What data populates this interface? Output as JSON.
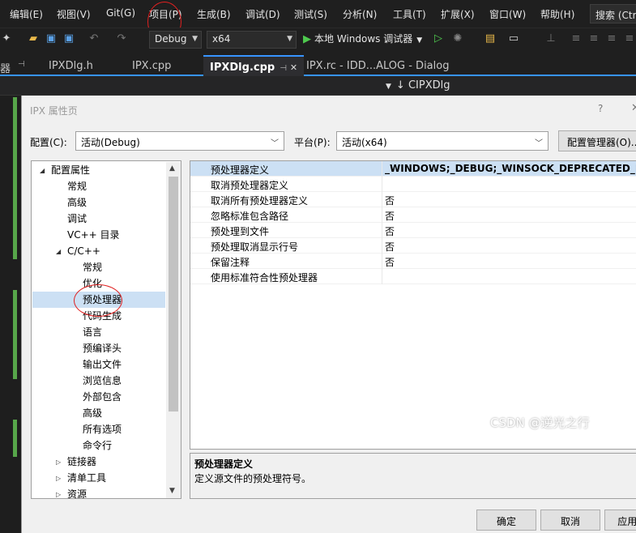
{
  "menu": {
    "items": [
      "编辑(E)",
      "视图(V)",
      "Git(G)",
      "项目(P)",
      "生成(B)",
      "调试(D)",
      "测试(S)",
      "分析(N)",
      "工具(T)",
      "扩展(X)",
      "窗口(W)",
      "帮助(H)"
    ],
    "search_label": "搜索 (Ctrl"
  },
  "toolbar": {
    "config_value": "Debug",
    "platform_value": "x64",
    "debugger_label": "本地 Windows 调试器"
  },
  "tabs": {
    "left_fragment": "器",
    "items": [
      "IPXDlg.h",
      "IPX.cpp",
      "IPXDlg.cpp",
      "IPX.rc - IDD...ALOG - Dialog"
    ]
  },
  "nav": {
    "class_name": "CIPXDlg"
  },
  "dialog": {
    "title": "IPX 属性页",
    "help_glyph": "?",
    "config_label": "配置(C):",
    "config_value": "活动(Debug)",
    "platform_label": "平台(P):",
    "platform_value": "活动(x64)",
    "config_manager_label": "配置管理器(O)...",
    "tree": [
      {
        "label": "配置属性",
        "twisty": "◢"
      },
      {
        "label": "常规"
      },
      {
        "label": "高级"
      },
      {
        "label": "调试"
      },
      {
        "label": "VC++ 目录"
      },
      {
        "label": "C/C++",
        "twisty": "◢"
      },
      {
        "label": "常规"
      },
      {
        "label": "优化"
      },
      {
        "label": "预处理器"
      },
      {
        "label": "代码生成"
      },
      {
        "label": "语言"
      },
      {
        "label": "预编译头"
      },
      {
        "label": "输出文件"
      },
      {
        "label": "浏览信息"
      },
      {
        "label": "外部包含"
      },
      {
        "label": "高级"
      },
      {
        "label": "所有选项"
      },
      {
        "label": "命令行"
      },
      {
        "label": "链接器",
        "twisty": "▷"
      },
      {
        "label": "清单工具",
        "twisty": "▷"
      },
      {
        "label": "资源",
        "twisty": "▷"
      }
    ],
    "properties": [
      {
        "name": "预处理器定义",
        "value": "_WINDOWS;_DEBUG;_WINSOCK_DEPRECATED_NO_W"
      },
      {
        "name": "取消预处理器定义",
        "value": ""
      },
      {
        "name": "取消所有预处理器定义",
        "value": "否"
      },
      {
        "name": "忽略标准包含路径",
        "value": "否"
      },
      {
        "name": "预处理到文件",
        "value": "否"
      },
      {
        "name": "预处理取消显示行号",
        "value": "否"
      },
      {
        "name": "保留注释",
        "value": "否"
      },
      {
        "name": "使用标准符合性预处理器",
        "value": ""
      }
    ],
    "description": {
      "title": "预处理器定义",
      "text": "定义源文件的预处理符号。"
    },
    "buttons": {
      "ok": "确定",
      "cancel": "取消",
      "apply": "应用(A)"
    }
  },
  "watermark": "CSDN @逆光之行",
  "colors": {
    "annotation": "#e02020",
    "selection": "#cce0f4",
    "accent": "#3794ff",
    "git_bar": "#57a64a"
  }
}
